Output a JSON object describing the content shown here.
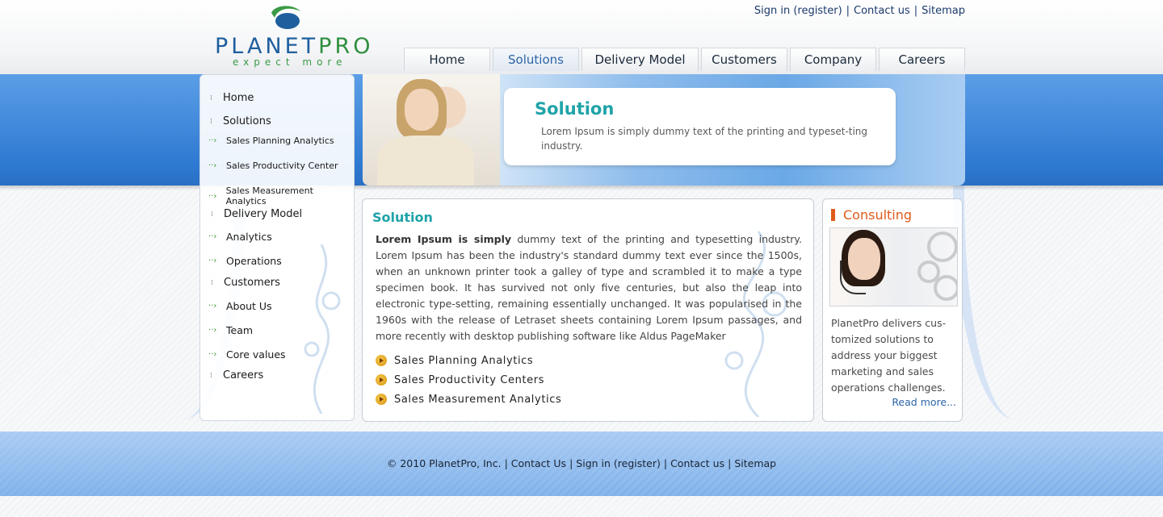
{
  "logo": {
    "name_part1": "PLANET",
    "name_part2": "PRO",
    "tagline": "expect more"
  },
  "toplinks": [
    "Sign in (register)",
    "Contact us",
    "Sitemap"
  ],
  "nav": [
    {
      "label": "Home",
      "active": false
    },
    {
      "label": "Solutions",
      "active": true
    },
    {
      "label": "Delivery Model",
      "active": false
    },
    {
      "label": "Customers",
      "active": false
    },
    {
      "label": "Company",
      "active": false
    },
    {
      "label": "Careers",
      "active": false
    }
  ],
  "sidebar": {
    "home": "Home",
    "solutions": "Solutions",
    "solutions_sub": [
      "Sales Planning Analytics",
      "Sales Productivity Center",
      "Sales Measurement Analytics"
    ],
    "delivery": "Delivery Model",
    "delivery_sub": [
      "Analytics",
      "Operations"
    ],
    "customers": "Customers",
    "customers_sub": [
      "About Us",
      "Team",
      "Core values"
    ],
    "careers": "Careers"
  },
  "banner": {
    "title": "Solution",
    "text": "Lorem Ipsum is simply dummy text of the printing and typeset-ting industry."
  },
  "main": {
    "title": "Solution",
    "lead": "Lorem Ipsum is simply",
    "body": " dummy text of the printing and typesetting industry. Lorem Ipsum has been the industry's standard dummy text ever since the 1500s, when an unknown printer took a galley of type and scrambled it to make a type specimen book. It has survived not only five centuries, but also the leap into electronic type-setting, remaining essentially unchanged. It was popularised in the 1960s with the release of Letraset sheets containing Lorem Ipsum passages, and more recently with desktop publishing software like Aldus PageMaker",
    "bullets": [
      "Sales Planning Analytics",
      "Sales Productivity Centers",
      "Sales Measurement Analytics"
    ]
  },
  "consulting": {
    "title": "Consulting",
    "text": "PlanetPro delivers cus-tomized solutions to address your biggest marketing and sales operations challenges.",
    "read_more": "Read more..."
  },
  "footer": {
    "copyright": "© 2010 PlanetPro, Inc.",
    "links": [
      "Contact Us",
      "Sign in (register)",
      "Contact us",
      "Sitemap"
    ]
  },
  "colors": {
    "accent_teal": "#1fa3a8",
    "accent_orange": "#e05a1a",
    "brand_blue": "#2c64a8",
    "band_blue": "#2f7ad2"
  }
}
